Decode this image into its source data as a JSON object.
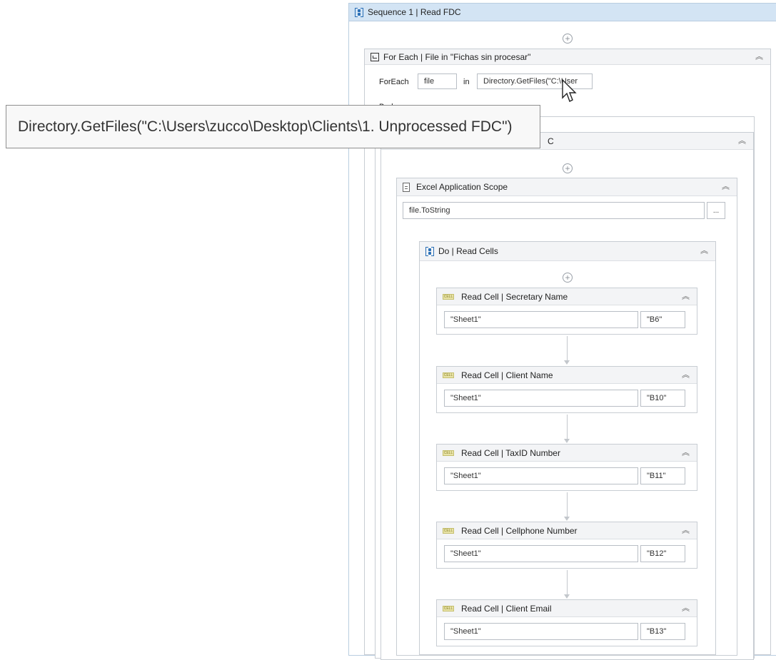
{
  "sequence": {
    "title": "Sequence 1 | Read FDC"
  },
  "foreach": {
    "title": "For Each | File in \"Fichas sin procesar\"",
    "foreach_label": "ForEach",
    "item_value": "file",
    "in_label": "in",
    "collection_value": "Directory.GetFiles(\"C:\\User",
    "body_label": "Body",
    "inner_title_fragment": "C"
  },
  "tooltip": {
    "text": "Directory.GetFiles(\"C:\\Users\\zucco\\Desktop\\Clients\\1. Unprocessed FDC\")"
  },
  "excel_scope": {
    "title": "Excel Application Scope",
    "path_value": "file.ToString",
    "browse_label": "..."
  },
  "do_sequence": {
    "title": "Do | Read Cells"
  },
  "read_cells": [
    {
      "title": "Read Cell | Secretary Name",
      "sheet": "\"Sheet1\"",
      "cell": "\"B6\""
    },
    {
      "title": "Read Cell | Client Name",
      "sheet": "\"Sheet1\"",
      "cell": "\"B10\""
    },
    {
      "title": "Read Cell | TaxID Number",
      "sheet": "\"Sheet1\"",
      "cell": "\"B11\""
    },
    {
      "title": "Read Cell | Cellphone Number",
      "sheet": "\"Sheet1\"",
      "cell": "\"B12\""
    },
    {
      "title": "Read Cell | Client Email",
      "sheet": "\"Sheet1\"",
      "cell": "\"B13\""
    }
  ],
  "icons": {
    "collapse": "chevron-double-up",
    "add": "plus-circle",
    "cell_icon_text": "CELL"
  },
  "colors": {
    "sequence_header_bg": "#cfe0f0",
    "accent": "#2a6fb6"
  }
}
